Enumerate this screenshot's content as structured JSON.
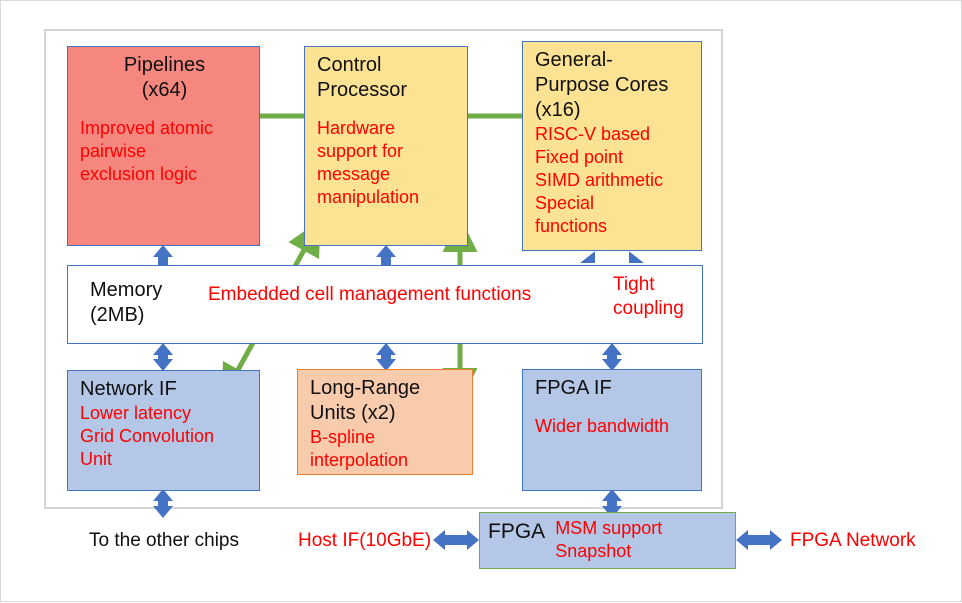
{
  "chip": {
    "boxes": {
      "pipelines": {
        "title": "Pipelines\n(x64)",
        "note": "Improved atomic\npairwise\nexclusion logic",
        "fill": "#F5877F",
        "border": "#4472C4"
      },
      "control_processor": {
        "title": "Control\nProcessor",
        "note": "Hardware\nsupport for\nmessage\nmanipulation",
        "fill": "#FCE394",
        "border": "#4472C4"
      },
      "general_purpose_cores": {
        "title": "General-\nPurpose Cores\n(x16)",
        "note": "RISC-V based\nFixed point\nSIMD arithmetic\nSpecial\nfunctions",
        "fill": "#FCE394",
        "border": "#4472C4"
      },
      "memory": {
        "title": "Memory\n(2MB)",
        "note": "Embedded cell management functions",
        "fill": "#FFFFFF",
        "border": "#4472C4"
      },
      "network_if": {
        "title": "Network IF",
        "note": "Lower latency\nGrid Convolution\nUnit",
        "fill": "#B4C7E7",
        "border": "#4472C4"
      },
      "long_range_units": {
        "title": "Long-Range\nUnits (x2)",
        "note": "B-spline\ninterpolation",
        "fill": "#F8CBAD",
        "border": "#ED7D31"
      },
      "fpga_if": {
        "title": "FPGA IF",
        "note": "Wider bandwidth",
        "fill": "#B4C7E7",
        "border": "#4472C4"
      },
      "fpga": {
        "title": "FPGA",
        "note": "MSM support\nSnapshot",
        "fill": "#B4C7E7",
        "border": "#70AD47"
      }
    },
    "annotations": {
      "tight_coupling": "Tight\ncoupling",
      "to_other_chips": "To the other chips",
      "host_if": "Host IF(10GbE)",
      "fpga_network": "FPGA Network"
    }
  },
  "colors": {
    "blue_arrow": "#4472C4",
    "green_arrow": "#70AD47",
    "red_text": "#FF0000",
    "black_text": "#101010",
    "page_border": "#D9D9D9",
    "chip_frame": "#D5D5D5"
  },
  "arrows": {
    "blue_vertical": [
      {
        "name": "pipelines-memory",
        "from": "pipelines",
        "to": "memory"
      },
      {
        "name": "control-memory",
        "from": "control_processor",
        "to": "memory"
      },
      {
        "name": "cores-memory",
        "from": "general_purpose_cores",
        "to": "memory",
        "style": "wide"
      },
      {
        "name": "memory-network-if",
        "from": "memory",
        "to": "network_if"
      },
      {
        "name": "memory-long-range",
        "from": "memory",
        "to": "long_range_units"
      },
      {
        "name": "memory-fpga-if",
        "from": "memory",
        "to": "fpga_if"
      },
      {
        "name": "network-if-other-chips",
        "from": "network_if",
        "to": "to_other_chips"
      },
      {
        "name": "fpga-if-fpga",
        "from": "fpga_if",
        "to": "fpga"
      }
    ],
    "blue_horizontal": [
      {
        "name": "host-if-fpga",
        "from": "host_if",
        "to": "fpga"
      },
      {
        "name": "fpga-fpga-network",
        "from": "fpga",
        "to": "fpga_network"
      }
    ],
    "green": [
      {
        "name": "pipelines-control",
        "from": "pipelines",
        "to": "control_processor",
        "heads": "both"
      },
      {
        "name": "cores-control",
        "from": "general_purpose_cores",
        "to": "control_processor",
        "heads": "one"
      },
      {
        "name": "control-network-if",
        "from": "control_processor",
        "to": "network_if",
        "heads": "both"
      },
      {
        "name": "control-long-range",
        "from": "control_processor",
        "to": "long_range_units",
        "heads": "both"
      }
    ]
  }
}
